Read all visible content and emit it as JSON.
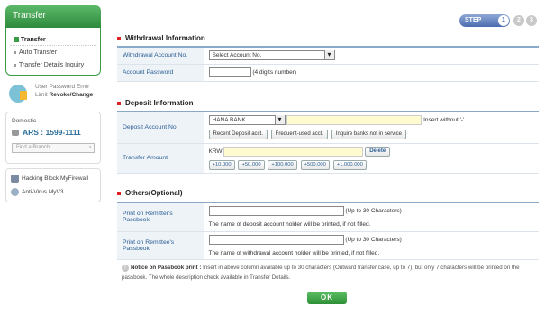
{
  "sidebar": {
    "title": "Transfer",
    "menu": [
      {
        "label": "Transfer"
      },
      {
        "label": "Auto Transfer"
      },
      {
        "label": "Transfer Details Inquiry"
      }
    ],
    "password_error": {
      "line1": "User Password Error",
      "limit": "Limit ",
      "revoke": "Revoke/Change"
    },
    "phone": {
      "domestic": "Domestic",
      "ars": "ARS : 1599-1111",
      "find_branch": "Find a Branch"
    },
    "security": [
      {
        "label": "Hacking Block MyFirewall"
      },
      {
        "label": "Anti-Virus MyV3"
      }
    ]
  },
  "steps": {
    "label": "STEP",
    "s1": "1",
    "s2": "2",
    "s3": "3"
  },
  "withdrawal": {
    "title": "Withdrawal Information",
    "account_label": "Withdrawal Account No.",
    "account_select": "Select Account No.",
    "password_label": "Account Password",
    "password_hint": "(4 digits number)"
  },
  "deposit": {
    "title": "Deposit Information",
    "account_label": "Deposit Account No.",
    "bank_select": "HANA BANK",
    "insert_hint": "Insert without '-'",
    "btn_recent": "Recent Deposit acct.",
    "btn_frequent": "Frequent-used acct.",
    "btn_inquire": "Inquire banks not in service",
    "amount_label": "Transfer Amount",
    "currency": "KRW",
    "delete": "Delete",
    "amounts": [
      "+10,000",
      "+50,000",
      "+100,000",
      "+500,000",
      "+1,000,000"
    ]
  },
  "others": {
    "title": "Others(Optional)",
    "remitter_label_1": "Print on Remitter's",
    "remitter_label_2": "Passbook",
    "remitter_hint": "(Up to 30 Characters)",
    "remitter_desc": "The name of deposit account holder will be printed, if not filled.",
    "remittee_label_1": "Print on Remittee's",
    "remittee_label_2": "Passbook",
    "remittee_hint": "(Up to 30 Characters)",
    "remittee_desc": "The name of withdrawal account holder will be printed, if not filled."
  },
  "notice": {
    "title": "Notice on Passbook print :",
    "text": " Insert in above column available up to 30 characters (Outward transfer case, up to 7), but only 7 characters will be printed on the passbook. The whole description check available in Transfer Details."
  },
  "ok_label": "OK"
}
